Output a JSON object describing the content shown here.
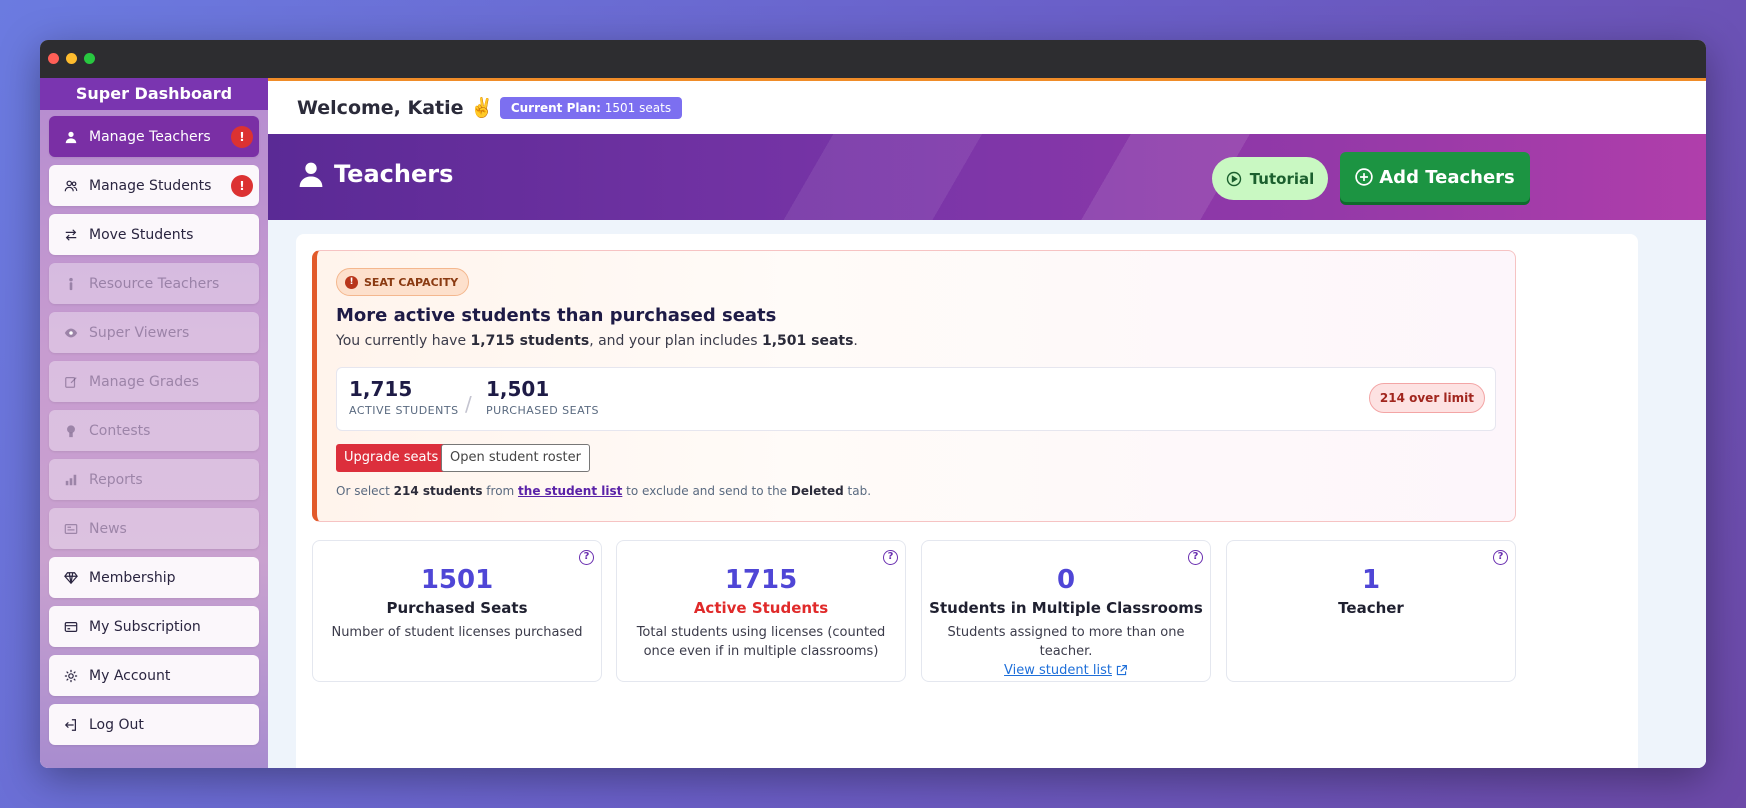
{
  "sidebar": {
    "title": "Super Dashboard",
    "items": [
      {
        "label": "Manage Teachers",
        "icon": "user-icon",
        "state": "active",
        "alert": "!"
      },
      {
        "label": "Manage Students",
        "icon": "users-icon",
        "state": "normal",
        "alert": "!"
      },
      {
        "label": "Move Students",
        "icon": "arrows-swap-icon",
        "state": "normal"
      },
      {
        "label": "Resource Teachers",
        "icon": "person-icon",
        "state": "disabled"
      },
      {
        "label": "Super Viewers",
        "icon": "eye-icon",
        "state": "disabled"
      },
      {
        "label": "Manage Grades",
        "icon": "edit-icon",
        "state": "disabled"
      },
      {
        "label": "Contests",
        "icon": "award-icon",
        "state": "disabled"
      },
      {
        "label": "Reports",
        "icon": "bar-chart-icon",
        "state": "disabled"
      },
      {
        "label": "News",
        "icon": "newspaper-icon",
        "state": "disabled"
      },
      {
        "label": "Membership",
        "icon": "diamond-icon",
        "state": "normal"
      },
      {
        "label": "My Subscription",
        "icon": "credit-card-icon",
        "state": "normal"
      },
      {
        "label": "My Account",
        "icon": "gear-icon",
        "state": "normal"
      },
      {
        "label": "Log Out",
        "icon": "logout-icon",
        "state": "normal"
      }
    ]
  },
  "topbar": {
    "welcome": "Welcome, Katie ✌️",
    "plan_label": "Current Plan:",
    "plan_value": "1501 seats"
  },
  "hero": {
    "title": "Teachers",
    "tutorial_label": "Tutorial",
    "add_label": "Add Teachers"
  },
  "alert": {
    "tag": "SEAT CAPACITY",
    "heading": "More active students than purchased seats",
    "text_prefix": "You currently have ",
    "text_students": "1,715 students",
    "text_mid": ", and your plan includes ",
    "text_seats": "1,501 seats",
    "text_suffix": ".",
    "active_value": "1,715",
    "active_label": "ACTIVE STUDENTS",
    "separator": "/",
    "purchased_value": "1,501",
    "purchased_label": "PURCHASED SEATS",
    "over_limit": "214 over limit",
    "upgrade_label": "Upgrade seats",
    "roster_label": "Open student roster",
    "foot_prefix": "Or select ",
    "foot_count": "214 students",
    "foot_from": " from ",
    "foot_link": "the student list",
    "foot_mid": " to exclude and send to the ",
    "foot_tab": "Deleted",
    "foot_suffix": " tab."
  },
  "metrics": [
    {
      "value": "1501",
      "title": "Purchased Seats",
      "desc": "Number of student licenses purchased"
    },
    {
      "value": "1715",
      "title": "Active Students",
      "desc": "Total students using licenses (counted once even if in multiple classrooms)"
    },
    {
      "value": "0",
      "title": "Students in Multiple Classrooms",
      "desc": "Students assigned to more than one teacher.",
      "link": "View student list"
    },
    {
      "value": "1",
      "title": "Teacher",
      "desc": ""
    }
  ],
  "colors": {
    "accent": "#7a2fa5",
    "metric_number": "#4f46d6",
    "danger": "#dc2f3c",
    "success": "#1c9442"
  }
}
